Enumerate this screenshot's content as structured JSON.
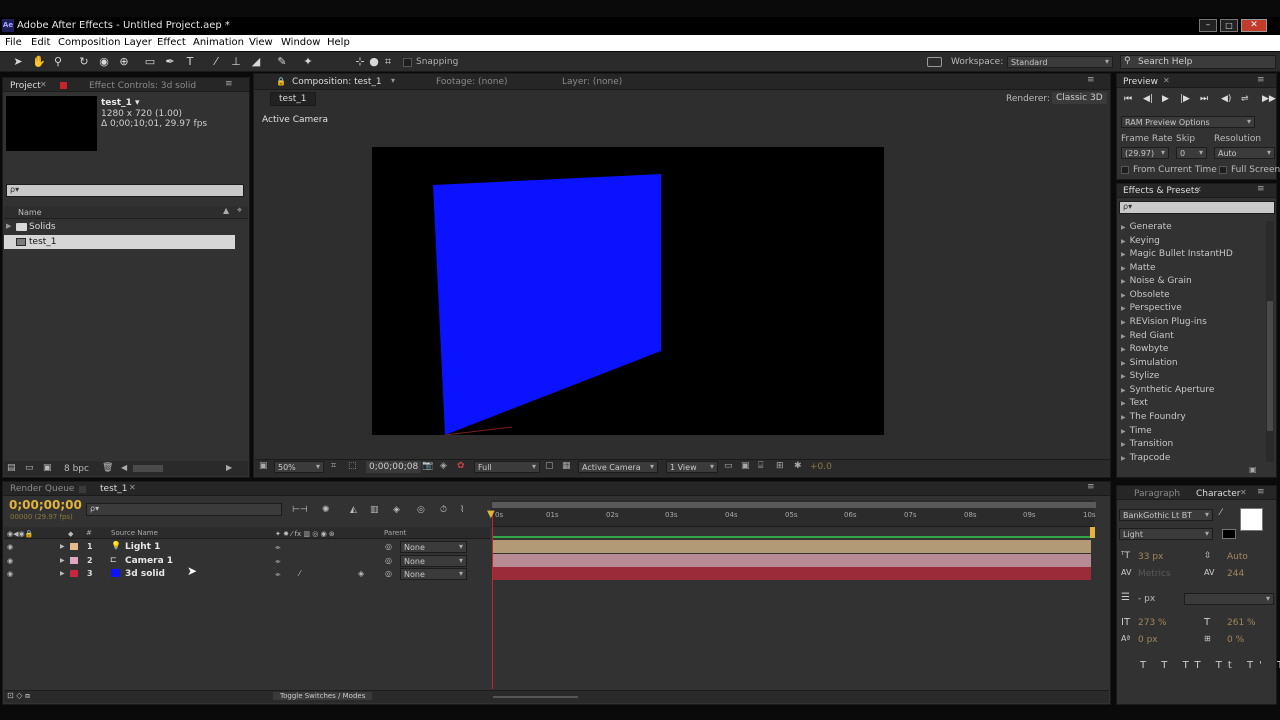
{
  "window": {
    "title": "Adobe After Effects - Untitled Project.aep *",
    "app_icon": "Ae"
  },
  "menu": [
    "File",
    "Edit",
    "Composition",
    "Layer",
    "Effect",
    "Animation",
    "View",
    "Window",
    "Help"
  ],
  "toolbar": {
    "snapping_label": "Snapping",
    "workspace_label": "Workspace:",
    "workspace_value": "Standard",
    "search_placeholder": "Search Help"
  },
  "project_panel": {
    "tab_project": "Project",
    "tab_effect_controls": "Effect Controls: 3d solid",
    "comp_name": "test_1 ▾",
    "comp_size": "1280 x 720 (1.00)",
    "comp_duration": "Δ 0;00;10;01, 29.97 fps",
    "search_placeholder": "ρ▾",
    "column_name": "Name",
    "items": [
      {
        "label": "Solids",
        "icon": "folder-icon"
      },
      {
        "label": "test_1",
        "icon": "composition-icon"
      }
    ],
    "bpc": "8 bpc"
  },
  "comp_panel": {
    "tab_composition": "Composition: test_1",
    "tab_footage": "Footage: (none)",
    "tab_layer": "Layer: (none)",
    "subtab": "test_1",
    "renderer_label": "Renderer:",
    "renderer_value": "Classic 3D",
    "active_camera_label": "Active Camera",
    "zoom": "50%",
    "timecode": "0;00;00;08",
    "resolution": "Full",
    "camera": "Active Camera",
    "views": "1 View",
    "exposure": "+0.0"
  },
  "preview_panel": {
    "tab": "Preview",
    "ram_options": "RAM Preview Options",
    "frame_rate_label": "Frame Rate",
    "skip_label": "Skip",
    "resolution_label": "Resolution",
    "frame_rate_value": "(29.97)",
    "skip_value": "0",
    "resolution_value": "Auto",
    "from_current_time": "From Current Time",
    "full_screen": "Full Screen"
  },
  "effects_panel": {
    "tab": "Effects & Presets",
    "search_placeholder": "ρ▾",
    "items": [
      "Generate",
      "Keying",
      "Magic Bullet InstantHD",
      "Matte",
      "Noise & Grain",
      "Obsolete",
      "Perspective",
      "REVision Plug-ins",
      "Red Giant",
      "Rowbyte",
      "Simulation",
      "Stylize",
      "Synthetic Aperture",
      "Text",
      "The Foundry",
      "Time",
      "Transition",
      "Trapcode"
    ]
  },
  "timeline": {
    "tab_render_queue": "Render Queue",
    "tab_comp": "test_1",
    "timecode": "0;00;00;00",
    "frame_info": "00000 (29.97 fps)",
    "search_placeholder": "ρ▾",
    "col_hash": "#",
    "col_source_name": "Source Name",
    "col_parent": "Parent",
    "ruler": [
      "0s",
      "01s",
      "02s",
      "03s",
      "04s",
      "05s",
      "06s",
      "07s",
      "08s",
      "09s",
      "10s"
    ],
    "layers": [
      {
        "num": "1",
        "name": "Light 1",
        "icon": "light-icon",
        "label_color": "#e8b98a",
        "parent": "None",
        "bar_color": "#b39a76"
      },
      {
        "num": "2",
        "name": "Camera 1",
        "icon": "camera-icon",
        "label_color": "#e0a6c4",
        "parent": "None",
        "bar_color": "#b88a93"
      },
      {
        "num": "3",
        "name": "3d solid",
        "icon": "solid-icon",
        "label_color": "#c8263a",
        "parent": "None",
        "bar_color": "#9b2b39"
      }
    ],
    "toggle_label": "Toggle Switches / Modes"
  },
  "character_panel": {
    "tab_paragraph": "Paragraph",
    "tab_character": "Character",
    "font_family": "BankGothic Lt BT",
    "font_style": "Light",
    "font_size": "33 px",
    "leading": "Auto",
    "kerning": "Metrics",
    "tracking": "244",
    "stroke_width": "- px",
    "vertical_scale": "273 %",
    "horizontal_scale": "261 %",
    "baseline_shift": "0 px",
    "tsume": "0 %"
  },
  "colors": {
    "solid_blue": "#0a12ff",
    "timecode_yellow": "#e3b43a",
    "cti_red": "#c8222a",
    "work_area_green": "#2ea84b"
  }
}
